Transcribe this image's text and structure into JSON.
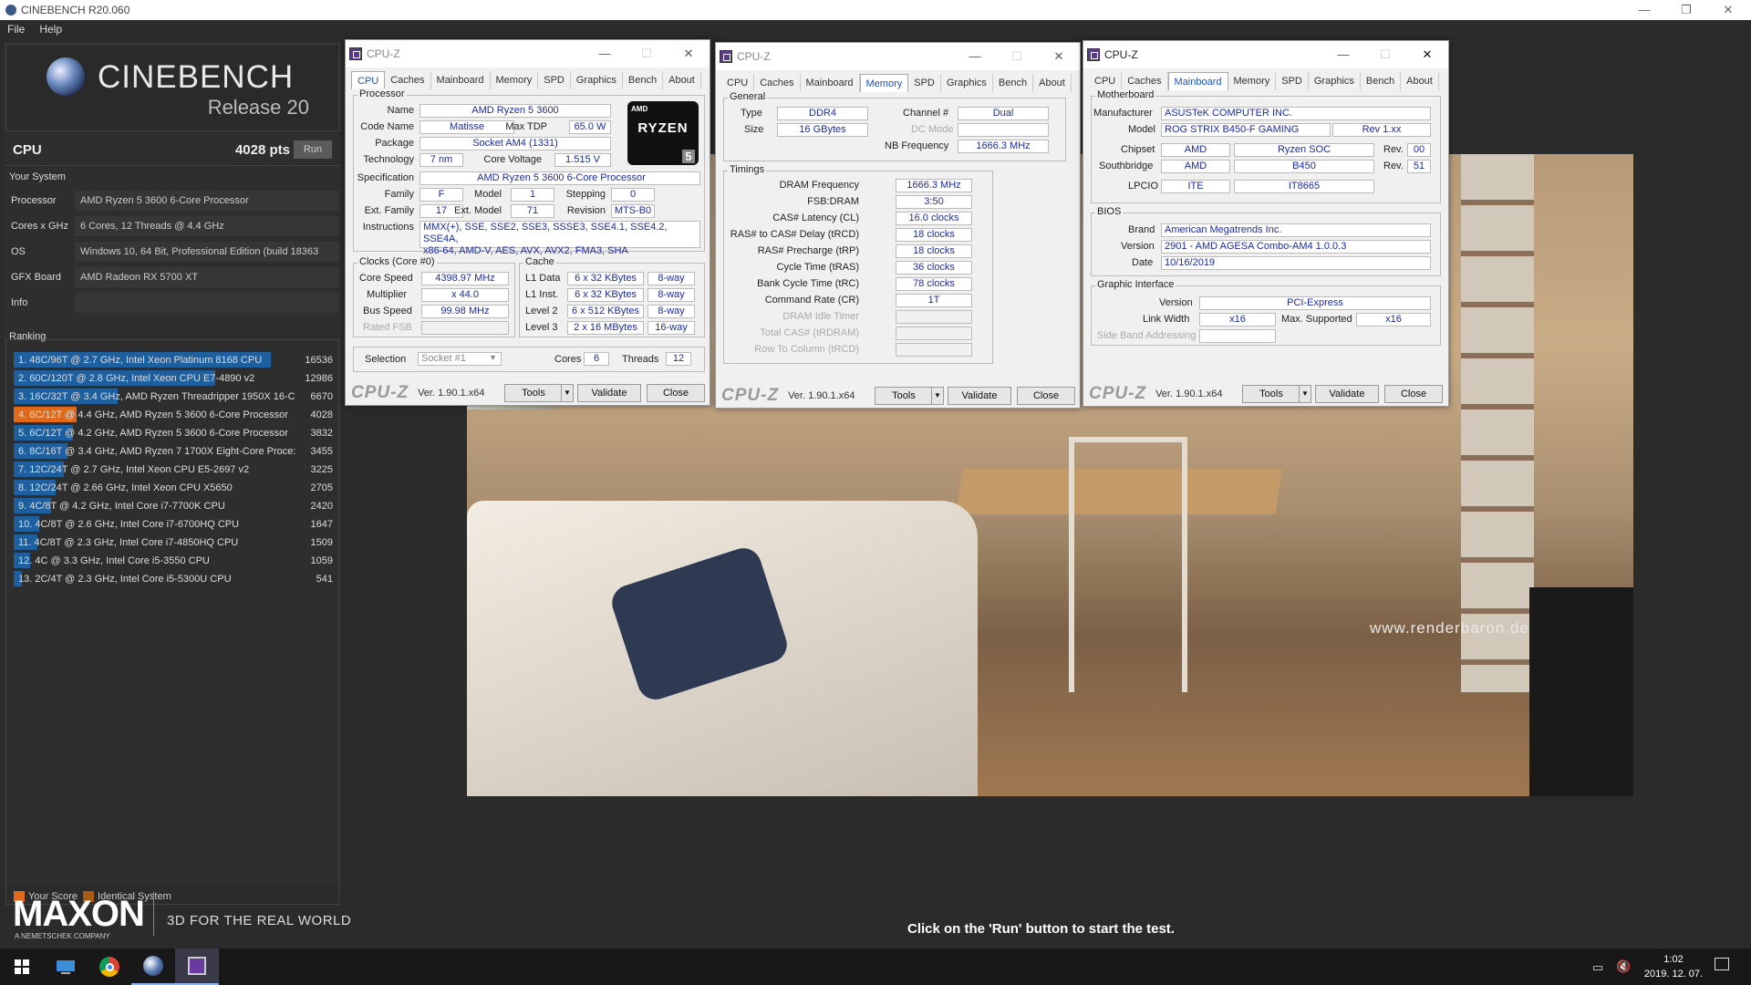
{
  "window": {
    "title": "CINEBENCH R20.060",
    "minimize": "—",
    "maximize": "❐",
    "close": "✕"
  },
  "menu": [
    "File",
    "Help"
  ],
  "cinebench": {
    "brand": "CINEBENCH",
    "release": "Release 20",
    "score_label": "CPU",
    "score": "4028 pts",
    "run_button": "Run",
    "your_system_title": "Your System",
    "system": [
      {
        "label": "Processor",
        "value": "AMD Ryzen 5 3600 6-Core Processor"
      },
      {
        "label": "Cores x GHz",
        "value": "6 Cores, 12 Threads @ 4.4 GHz"
      },
      {
        "label": "OS",
        "value": "Windows 10, 64 Bit, Professional Edition (build 18363"
      },
      {
        "label": "GFX Board",
        "value": "AMD Radeon RX 5700 XT"
      },
      {
        "label": "Info",
        "value": ""
      }
    ],
    "ranking_title": "Ranking",
    "ranking": [
      {
        "name": "1. 48C/96T @ 2.7 GHz, Intel Xeon Platinum 8168 CPU",
        "score": "16536",
        "fraction": 1.0,
        "color": "#1e5fa0"
      },
      {
        "name": "2. 60C/120T @ 2.8 GHz, Intel Xeon CPU E7-4890 v2",
        "score": "12986",
        "fraction": 0.785,
        "color": "#1e5fa0"
      },
      {
        "name": "3. 16C/32T @ 3.4 GHz, AMD Ryzen Threadripper 1950X 16-C",
        "score": "6670",
        "fraction": 0.403,
        "color": "#1e5fa0"
      },
      {
        "name": "4. 6C/12T @ 4.4 GHz, AMD Ryzen 5 3600 6-Core Processor",
        "score": "4028",
        "fraction": 0.244,
        "color": "#e06a1a"
      },
      {
        "name": "5. 6C/12T @ 4.2 GHz, AMD Ryzen 5 3600 6-Core Processor",
        "score": "3832",
        "fraction": 0.232,
        "color": "#1e5fa0"
      },
      {
        "name": "6. 8C/16T @ 3.4 GHz, AMD Ryzen 7 1700X Eight-Core Proce:",
        "score": "3455",
        "fraction": 0.209,
        "color": "#1e5fa0"
      },
      {
        "name": "7. 12C/24T @ 2.7 GHz, Intel Xeon CPU E5-2697 v2",
        "score": "3225",
        "fraction": 0.195,
        "color": "#1e5fa0"
      },
      {
        "name": "8. 12C/24T @ 2.66 GHz, Intel Xeon CPU X5650",
        "score": "2705",
        "fraction": 0.164,
        "color": "#1e5fa0"
      },
      {
        "name": "9. 4C/8T @ 4.2 GHz, Intel Core i7-7700K CPU",
        "score": "2420",
        "fraction": 0.146,
        "color": "#1e5fa0"
      },
      {
        "name": "10. 4C/8T @ 2.6 GHz, Intel Core i7-6700HQ CPU",
        "score": "1647",
        "fraction": 0.1,
        "color": "#1e5fa0"
      },
      {
        "name": "11. 4C/8T @ 2.3 GHz, Intel Core i7-4850HQ CPU",
        "score": "1509",
        "fraction": 0.091,
        "color": "#1e5fa0"
      },
      {
        "name": "12. 4C @ 3.3 GHz, Intel Core i5-3550 CPU",
        "score": "1059",
        "fraction": 0.064,
        "color": "#1e5fa0"
      },
      {
        "name": "13. 2C/4T @ 2.3 GHz, Intel Core i5-5300U CPU",
        "score": "541",
        "fraction": 0.033,
        "color": "#1e5fa0"
      }
    ],
    "legend_your_score": "Your Score",
    "legend_identical": "Identical System",
    "maxon": "MAXON",
    "maxon_sub": "A NEMETSCHEK COMPANY",
    "tagline": "3D FOR THE REAL WORLD",
    "status": "Click on the 'Run' button to start the test.",
    "watermark": "www.renderbaron.de"
  },
  "cpuz_common": {
    "title": "CPU-Z",
    "tabs": [
      "CPU",
      "Caches",
      "Mainboard",
      "Memory",
      "SPD",
      "Graphics",
      "Bench",
      "About"
    ],
    "logo": "CPU-Z",
    "version": "Ver. 1.90.1.x64",
    "tools": "Tools",
    "validate": "Validate",
    "close": "Close",
    "min": "—",
    "max": "☐",
    "x": "✕"
  },
  "cpuz_cpu": {
    "processor_group": "Processor",
    "name_l": "Name",
    "name": "AMD Ryzen 5 3600",
    "code_l": "Code Name",
    "code": "Matisse",
    "tdp_l": "Max TDP",
    "tdp": "65.0 W",
    "pkg_l": "Package",
    "pkg": "Socket AM4 (1331)",
    "tech_l": "Technology",
    "tech": "7 nm",
    "cv_l": "Core Voltage",
    "cv": "1.515 V",
    "spec_l": "Specification",
    "spec": "AMD Ryzen 5 3600 6-Core Processor",
    "family_l": "Family",
    "family": "F",
    "model_l": "Model",
    "model": "1",
    "step_l": "Stepping",
    "step": "0",
    "efam_l": "Ext. Family",
    "efam": "17",
    "emod_l": "Ext. Model",
    "emod": "71",
    "rev_l": "Revision",
    "rev": "MTS-B0",
    "instr_l": "Instructions",
    "instr1": "MMX(+), SSE, SSE2, SSE3, SSSE3, SSE4.1, SSE4.2, SSE4A,",
    "instr2": "x86-64, AMD-V, AES, AVX, AVX2, FMA3, SHA",
    "clocks_group": "Clocks (Core #0)",
    "cs_l": "Core Speed",
    "cs": "4398.97 MHz",
    "mul_l": "Multiplier",
    "mul": "x 44.0",
    "bus_l": "Bus Speed",
    "bus": "99.98 MHz",
    "fsb_l": "Rated FSB",
    "fsb": "",
    "cache_group": "Cache",
    "l1d_l": "L1 Data",
    "l1d": "6 x 32 KBytes",
    "l1d_w": "8-way",
    "l1i_l": "L1 Inst.",
    "l1i": "6 x 32 KBytes",
    "l1i_w": "8-way",
    "l2_l": "Level 2",
    "l2": "6 x 512 KBytes",
    "l2_w": "8-way",
    "l3_l": "Level 3",
    "l3": "2 x 16 MBytes",
    "l3_w": "16-way",
    "sel_l": "Selection",
    "sel": "Socket #1",
    "cores_l": "Cores",
    "cores": "6",
    "threads_l": "Threads",
    "threads": "12",
    "badge_top": "AMD",
    "badge_mid": "RYZEN",
    "badge_num": "5"
  },
  "cpuz_mem": {
    "general_group": "General",
    "type_l": "Type",
    "type": "DDR4",
    "ch_l": "Channel #",
    "ch": "Dual",
    "size_l": "Size",
    "size": "16 GBytes",
    "dc_l": "DC Mode",
    "dc": "",
    "nb_l": "NB Frequency",
    "nb": "1666.3 MHz",
    "timings_group": "Timings",
    "timings": [
      {
        "l": "DRAM Frequency",
        "v": "1666.3 MHz",
        "dim": false
      },
      {
        "l": "FSB:DRAM",
        "v": "3:50",
        "dim": false
      },
      {
        "l": "CAS# Latency (CL)",
        "v": "16.0 clocks",
        "dim": false
      },
      {
        "l": "RAS# to CAS# Delay (tRCD)",
        "v": "18 clocks",
        "dim": false
      },
      {
        "l": "RAS# Precharge (tRP)",
        "v": "18 clocks",
        "dim": false
      },
      {
        "l": "Cycle Time (tRAS)",
        "v": "36 clocks",
        "dim": false
      },
      {
        "l": "Bank Cycle Time (tRC)",
        "v": "78 clocks",
        "dim": false
      },
      {
        "l": "Command Rate (CR)",
        "v": "1T",
        "dim": false
      },
      {
        "l": "DRAM Idle Timer",
        "v": "",
        "dim": true
      },
      {
        "l": "Total CAS# (tRDRAM)",
        "v": "",
        "dim": true
      },
      {
        "l": "Row To Column (tRCD)",
        "v": "",
        "dim": true
      }
    ]
  },
  "cpuz_mb": {
    "mb_group": "Motherboard",
    "man_l": "Manufacturer",
    "man": "ASUSTeK COMPUTER INC.",
    "model_l": "Model",
    "model": "ROG STRIX B450-F GAMING",
    "model_rev": "Rev 1.xx",
    "chip_l": "Chipset",
    "chip1": "AMD",
    "chip2": "Ryzen SOC",
    "chip_rev_l": "Rev.",
    "chip_rev": "00",
    "sb_l": "Southbridge",
    "sb1": "AMD",
    "sb2": "B450",
    "sb_rev_l": "Rev.",
    "sb_rev": "51",
    "lpc_l": "LPCIO",
    "lpc1": "ITE",
    "lpc2": "IT8665",
    "bios_group": "BIOS",
    "brand_l": "Brand",
    "brand": "American Megatrends Inc.",
    "ver_l": "Version",
    "ver": "2901 - AMD AGESA Combo-AM4 1.0.0.3",
    "date_l": "Date",
    "date": "10/16/2019",
    "gi_group": "Graphic Interface",
    "giv_l": "Version",
    "giv": "PCI-Express",
    "lw_l": "Link Width",
    "lw": "x16",
    "ms_l": "Max. Supported",
    "ms": "x16",
    "sba_l": "Side Band Addressing",
    "sba": ""
  },
  "taskbar": {
    "time": "1:02",
    "date": "2019. 12. 07."
  }
}
